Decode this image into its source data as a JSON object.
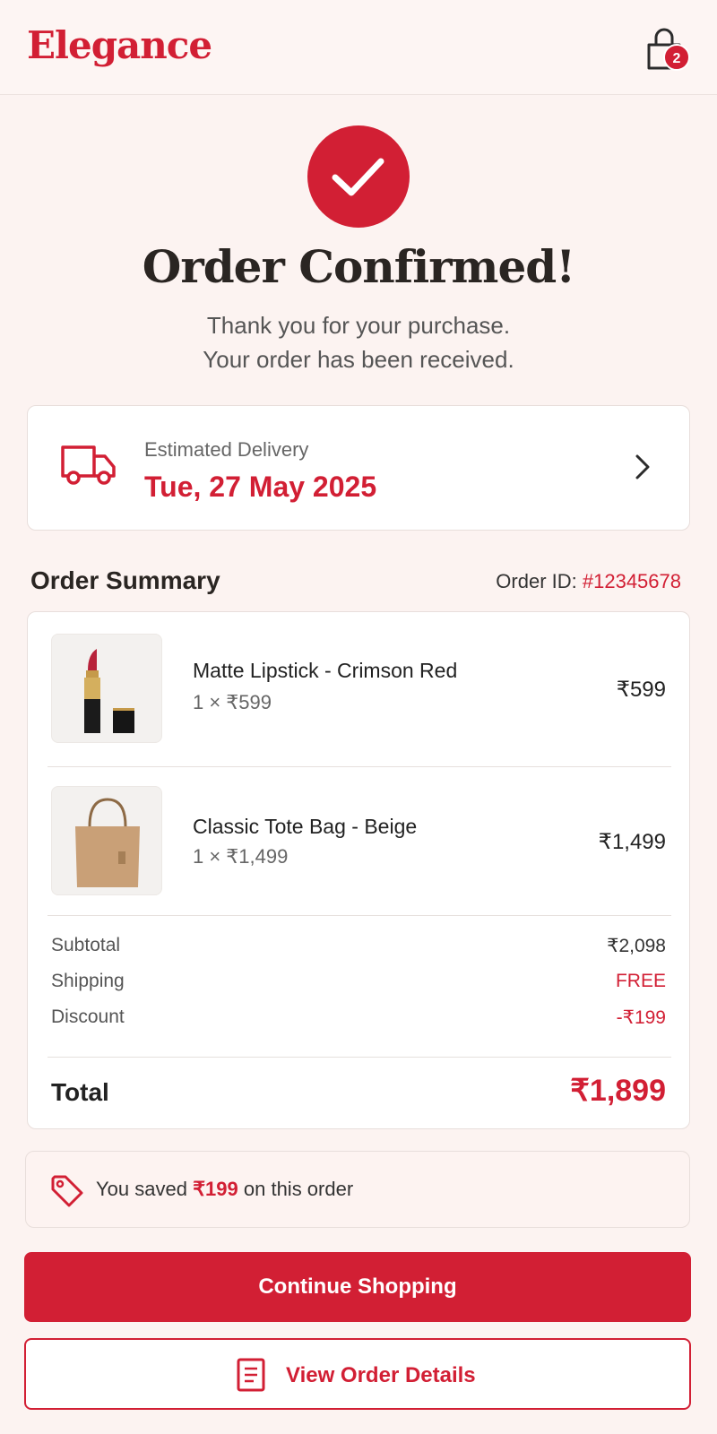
{
  "header": {
    "brand": "Elegance",
    "cart_count": "2"
  },
  "confirmation": {
    "title": "Order Confirmed!",
    "line1": "Thank you for your purchase.",
    "line2": "Your order has been received."
  },
  "delivery": {
    "label": "Estimated Delivery",
    "date": "Tue, 27 May 2025"
  },
  "summary": {
    "title": "Order Summary",
    "order_id_label": "Order ID: ",
    "order_id": "#12345678",
    "items": [
      {
        "name": "Matte Lipstick - Crimson Red",
        "qty": "1 × ₹599",
        "price": "₹599"
      },
      {
        "name": "Classic Tote Bag - Beige",
        "qty": "1 × ₹1,499",
        "price": "₹1,499"
      }
    ],
    "subtotal_label": "Subtotal",
    "subtotal": "₹2,098",
    "shipping_label": "Shipping",
    "shipping": "FREE",
    "discount_label": "Discount",
    "discount": "-₹199",
    "total_label": "Total",
    "total": "₹1,899"
  },
  "savings": {
    "prefix": "You saved ",
    "amount": "₹199",
    "suffix": " on this order"
  },
  "buttons": {
    "continue": "Continue Shopping",
    "view_details": "View Order Details"
  },
  "colors": {
    "accent": "#d21f34",
    "background": "#fcf3f1"
  }
}
